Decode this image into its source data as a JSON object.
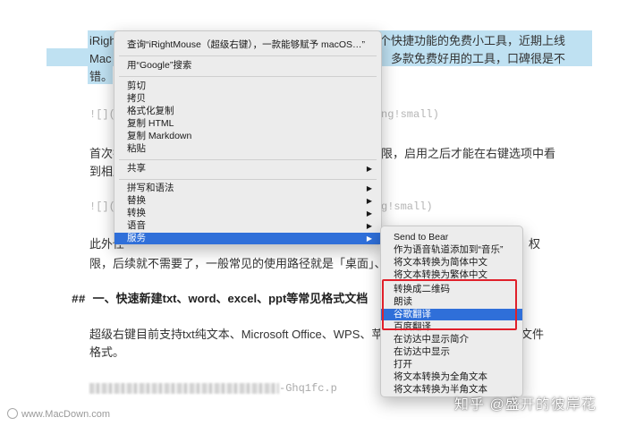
{
  "document": {
    "para1_line1": "iRigh",
    "para1_line1_tail": "个快捷功能的免费小工具，近期上线",
    "para1_line2": "Mac",
    "para1_line2_tail": "多款免费好用的工具，口碑很是不",
    "para1_line3": "错。",
    "img1_head": "![](",
    "img1_tail": "ng!small)",
    "para2_line1": "首次打",
    "para2_line1_tail": "限，启用之后才能在右键选项中看",
    "para2_line2": "到相应",
    "img2_head": "![](",
    "img2_tail": "g!small)",
    "para3_line1": "此外任",
    "para3_line1_tail": "权",
    "para3_line2": "限，后续就不需要了，一般常见的使用路径就是「桌面」、「下",
    "heading_hash": "##",
    "heading_text": "一、快速新建txt、word、excel、ppt等常见格式文档",
    "para4_line1": "超级右键目前支持txt纯文本、Microsoft Office、WPS、苹果",
    "para4_line1_tail": "文件",
    "para4_line2": "格式。",
    "blurred_tail": "-Ghq1fc.p"
  },
  "context_menu": {
    "items": [
      {
        "label": "查询“iRightMouse（超级右键），一款能够赋予 macOS…”",
        "submenu": false
      },
      {
        "label": "用“Google”搜索",
        "submenu": false
      },
      {
        "label": "剪切",
        "submenu": false
      },
      {
        "label": "拷贝",
        "submenu": false
      },
      {
        "label": "格式化复制",
        "submenu": false
      },
      {
        "label": "复制 HTML",
        "submenu": false
      },
      {
        "label": "复制 Markdown",
        "submenu": false
      },
      {
        "label": "粘贴",
        "submenu": false
      },
      {
        "label": "共享",
        "submenu": true
      },
      {
        "label": "拼写和语法",
        "submenu": true
      },
      {
        "label": "替换",
        "submenu": true
      },
      {
        "label": "转换",
        "submenu": true
      },
      {
        "label": "语音",
        "submenu": true
      },
      {
        "label": "服务",
        "submenu": true,
        "highlighted": true
      }
    ],
    "arrow_glyph": "▶"
  },
  "services_menu": {
    "items": [
      {
        "label": "Send to Bear"
      },
      {
        "label": "作为语音轨道添加到“音乐”"
      },
      {
        "label": "将文本转换为简体中文"
      },
      {
        "label": "将文本转换为繁体中文"
      },
      {
        "label": "转换成二维码"
      },
      {
        "label": "朗读"
      },
      {
        "label": "谷歌翻译",
        "highlighted": true
      },
      {
        "label": "百度翻译"
      },
      {
        "label": "在访达中显示简介"
      },
      {
        "label": "在访达中显示"
      },
      {
        "label": "打开"
      },
      {
        "label": "将文本转换为全角文本"
      },
      {
        "label": "将文本转换为半角文本"
      }
    ]
  },
  "watermarks": {
    "left": "www.MacDown.com",
    "right": "知乎 @盛开的彼岸花"
  },
  "colors": {
    "selection": "#bfe1f2",
    "menu_bg": "#ececec",
    "highlight": "#2f6fd9",
    "red_box": "#e0202a"
  }
}
